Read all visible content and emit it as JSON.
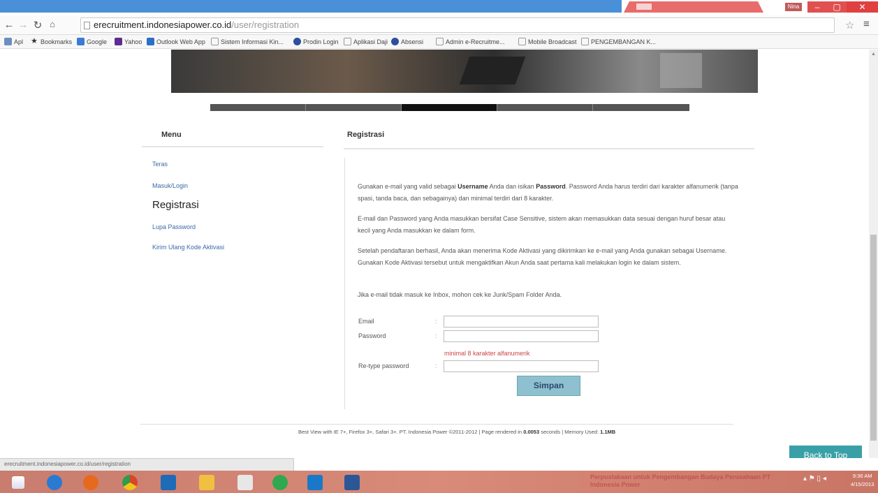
{
  "window": {
    "user": "Nina",
    "min": "–",
    "max": "▢",
    "close": "✕"
  },
  "browser": {
    "url_domain": "erecruitment.indonesiapower.co.id",
    "url_path": "/user/registration",
    "bookmarks": [
      "Apl",
      "Bookmarks",
      "Google",
      "Yahoo",
      "Outlook Web App",
      "Sistem Informasi Kin...",
      "Prodin Login",
      "Aplikasi Daji",
      "Absensi",
      "Admin e-Recruitme...",
      "Mobile Broadcast",
      "PENGEMBANGAN K..."
    ]
  },
  "sidebar": {
    "title": "Menu",
    "items": [
      {
        "label": "Teras"
      },
      {
        "label": "Masuk/Login"
      },
      {
        "label": "Registrasi"
      },
      {
        "label": "Lupa Password"
      },
      {
        "label": "Kirim Ulang Kode Aktivasi"
      }
    ]
  },
  "main": {
    "title": "Registrasi",
    "p1a": "Gunakan e-mail yang valid sebagai ",
    "p1b": "Username",
    "p1c": " Anda dan isikan ",
    "p1d": "Password",
    "p1e": ". Password Anda harus terdiri dari karakter alfanumerik (tanpa spasi, tanda baca, dan sebagainya) dan minimal terdiri dari 8 karakter.",
    "p2": "E-mail dan Password yang Anda masukkan bersifat Case Sensitive, sistem akan memasukkan data sesuai dengan huruf besar atau kecil yang Anda masukkan ke dalam form.",
    "p3": "Setelah pendaftaran berhasil, Anda akan menerima Kode Aktivasi yang dikirimkan ke e-mail yang Anda gunakan sebagai Username. Gunakan Kode Aktivasi tersebut untuk mengaktifkan Akun Anda saat pertama kali melakukan login ke dalam sistem.",
    "p4": "Jika e-mail tidak masuk ke Inbox, mohon cek ke Junk/Spam Folder Anda.",
    "form": {
      "email_label": "Email",
      "password_label": "Password",
      "retype_label": "Re-type password",
      "colon": ":",
      "hint": "minimal 8 karakter alfanumerik",
      "submit": "Simpan"
    }
  },
  "footer": {
    "a": "Best View with IE 7+, Firefox 3+, Safari 3+. PT. Indonesia Power ©2011-2012 | Page rendered in ",
    "time": "0.0053",
    "b": " seconds | Memory Used: ",
    "mem": "1.1MB"
  },
  "back_to_top": "Back to Top",
  "status_url": "erecruitment.indonesiapower.co.id/user/registration",
  "taskbar": {
    "notice": "Perpustakaan untuk Pengembangan Budaya Perusahaan PT Indonesia Power",
    "time": "9:36 AM",
    "date": "4/15/2013"
  }
}
